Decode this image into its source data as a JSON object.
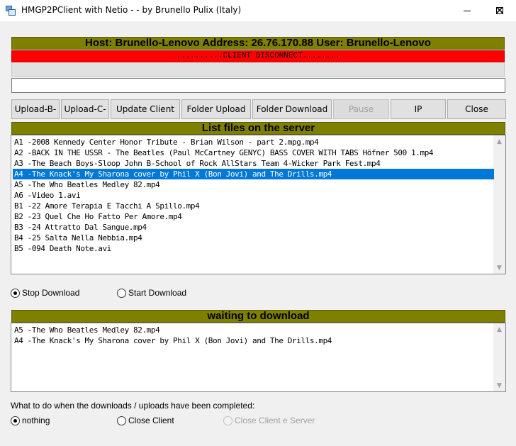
{
  "window": {
    "title": "HMGP2PClient with Netio -  - by Brunello Pulix (Italy)",
    "app_icon": "app-window-icon",
    "minimize_icon": "minimize-icon",
    "maximize_icon": "maximize-icon",
    "close_symbol": "✕"
  },
  "host_bar": {
    "text": "Host: Brunello-Lenovo    Address: 26.76.170.88    User: Brunello-Lenovo"
  },
  "status_bar": {
    "text": "..........CLIENT DISCONNECT........"
  },
  "input": {
    "value": ""
  },
  "buttons": {
    "upload_b": "Upload-B-",
    "upload_c": "Upload-C-",
    "update_client": "Update Client",
    "folder_upload": "Folder Upload",
    "folder_download": "Folder Download",
    "pause": "Pause",
    "ip": "IP",
    "close": "Close"
  },
  "server_files": {
    "title": "List files on the server",
    "items": [
      "A1 -2008 Kennedy Center Honor Tribute - Brian Wilson - part 2.mpg.mp4",
      "A2 -BACK IN THE USSR - The Beatles (Paul McCartney GENYC) BASS COVER WITH TABS Höfner 500 1.mp4",
      "A3 -The Beach Boys-Sloop John B-School of Rock AllStars Team 4-Wicker Park Fest.mp4",
      "A4 -The Knack's My Sharona cover by Phil X (Bon Jovi) and The Drills.mp4",
      "A5 -The Who Beatles Medley 82.mp4",
      "A6 -Video 1.avi",
      "B1 -22 Amore Terapia E Tacchi A Spillo.mp4",
      "B2 -23 Quel Che Ho Fatto Per Amore.mp4",
      "B3 -24 Attratto Dal Sangue.mp4",
      "B4 -25 Salta Nella Nebbia.mp4",
      "B5 -094 Death Note.avi"
    ],
    "selected_index": 3
  },
  "download_mode": {
    "stop_label": "Stop Download",
    "start_label": "Start Download",
    "selected": "stop"
  },
  "waiting": {
    "title": "waiting to download",
    "items": [
      "A5 -The Who Beatles Medley 82.mp4",
      "A4 -The Knack's My Sharona cover by Phil X (Bon Jovi) and The Drills.mp4"
    ]
  },
  "completion": {
    "question": "What to do when the downloads / uploads have been completed:",
    "nothing_label": "nothing",
    "close_client_label": "Close Client",
    "close_client_server_label": "Close Client e Server",
    "selected": "nothing"
  },
  "colors": {
    "header_bg": "#808000",
    "status_bg": "#ff0000",
    "selection_bg": "#0078d7"
  }
}
